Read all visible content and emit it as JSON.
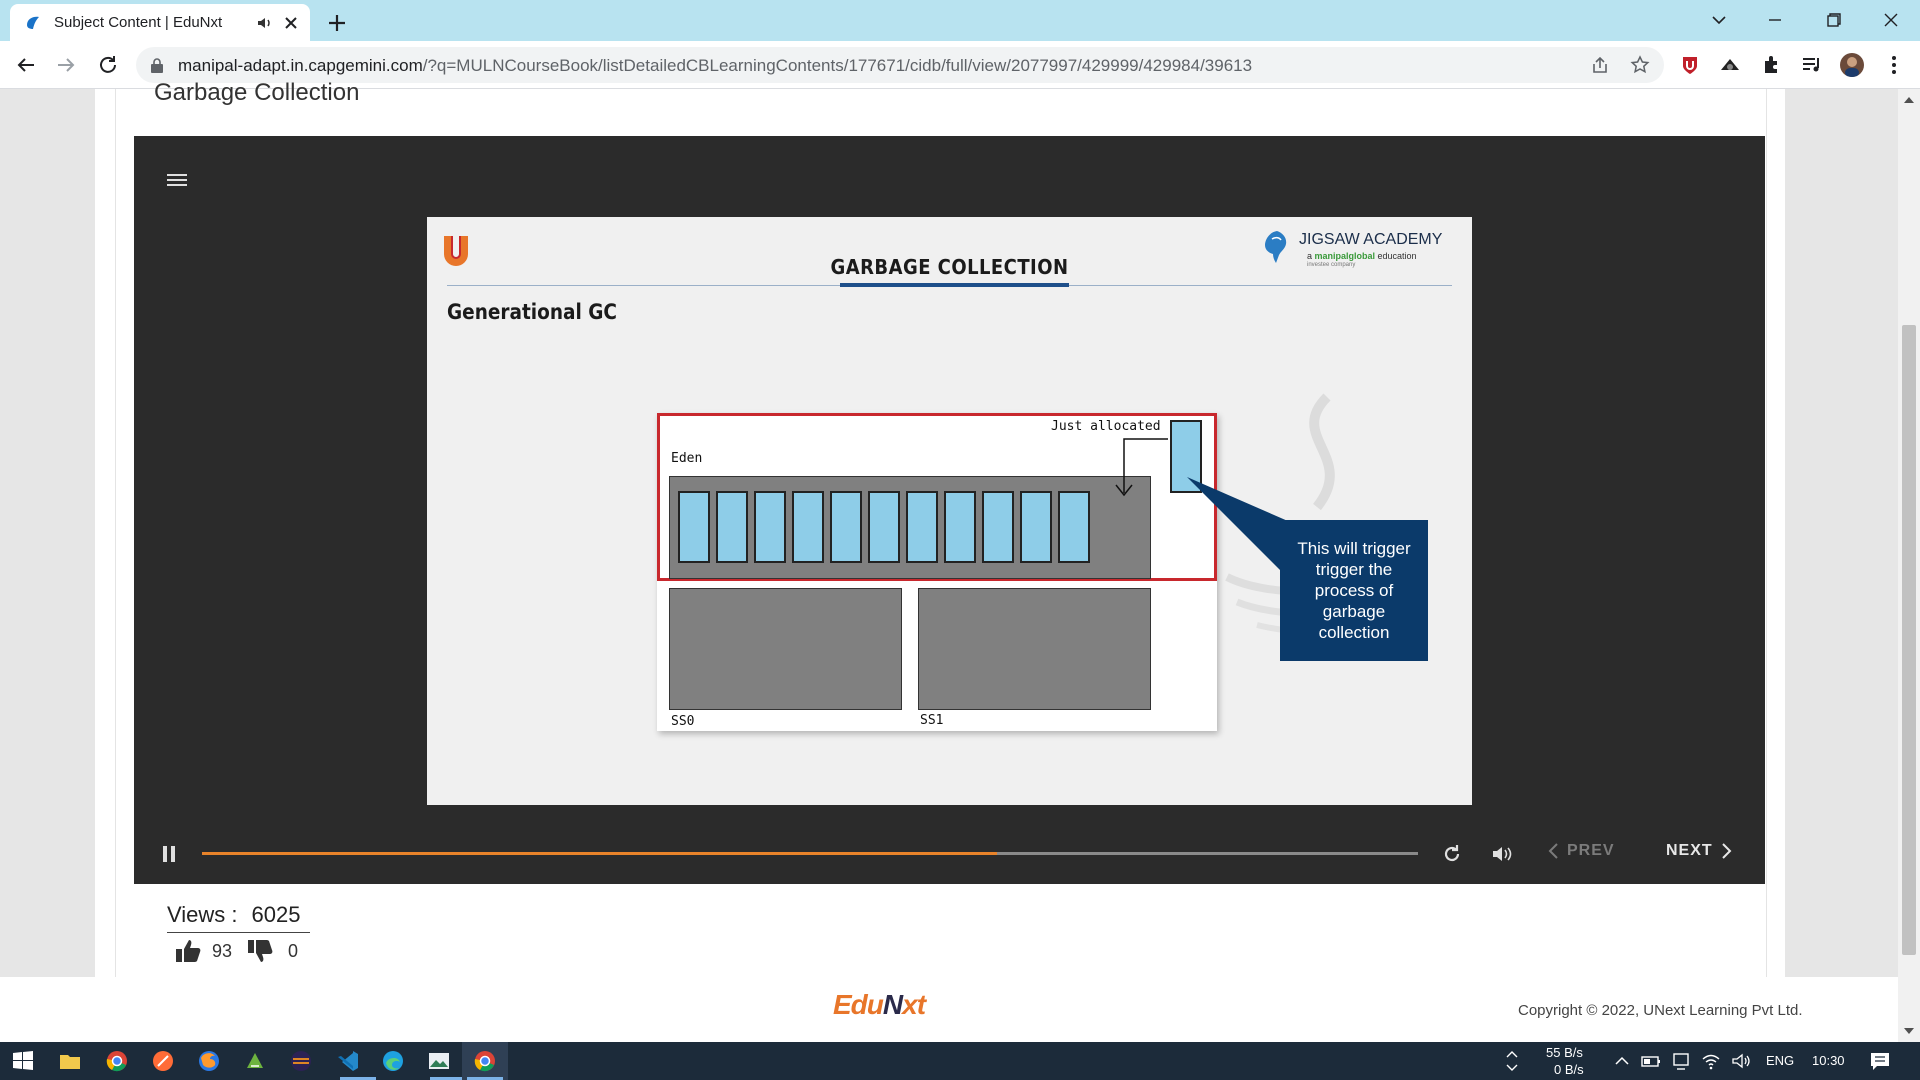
{
  "browser": {
    "tab_title": "Subject Content | EduNxt",
    "url_host": "manipal-adapt.in.capgemini.com",
    "url_path": "/?q=MULNCourseBook/listDetailedCBLearningContents/177671/cidb/full/view/2077997/429999/429984/39613"
  },
  "page": {
    "subject_title": "Garbage Collection"
  },
  "slide": {
    "title": "GARBAGE COLLECTION",
    "subtitle": "Generational GC",
    "brand_name": "JIGSAW ACADEMY",
    "brand_sub_prefix": "a ",
    "brand_sub_green": "manipalglobal",
    "brand_sub_suffix": " education",
    "brand_tiny": "investee company",
    "diagram": {
      "eden_label": "Eden",
      "just_allocated_label": "Just allocated",
      "ss0_label": "SS0",
      "ss1_label": "SS1"
    },
    "callout_text": "This will trigger trigger the process of garbage collection"
  },
  "player": {
    "progress": 0.654,
    "prev_label": "PREV",
    "next_label": "NEXT"
  },
  "stats": {
    "views_label": "Views :",
    "views_count": "6025",
    "likes": "93",
    "dislikes": "0"
  },
  "footer": {
    "logo_text_1": "Edu",
    "logo_text_2": "N",
    "logo_text_3": "xt",
    "copyright": "Copyright © 2022, UNext Learning Pvt Ltd."
  },
  "taskbar": {
    "net_up": "55 B/s",
    "net_down": "0 B/s",
    "lang": "ENG",
    "time": "10:30"
  },
  "colors": {
    "tab_strip": "#b8e3f0",
    "accent_orange": "#e8832a",
    "eden_border": "#c8282d",
    "callout_bg": "#0b3a6a",
    "cell_fill": "#8ecde8"
  }
}
